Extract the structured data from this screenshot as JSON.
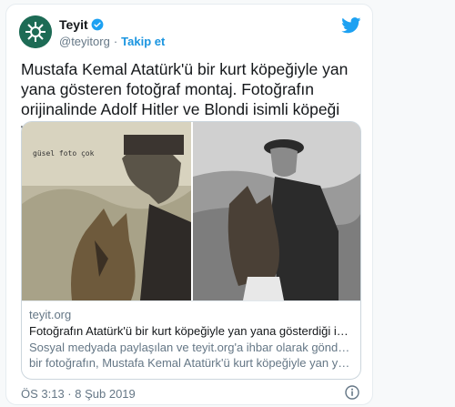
{
  "user": {
    "name": "Teyit",
    "handle": "@teyitorg",
    "separator": "·",
    "follow_label": "Takip et"
  },
  "tweet": {
    "text": "Mustafa Kemal Atatürk'ü bir kurt köpeğiyle yan yana gösteren fotoğraf montaj. Fotoğrafın orijinalinde Adolf Hitler ve Blondi isimli köpeği yer alıyor."
  },
  "card": {
    "photo_caption": "güsel foto çok",
    "domain": "teyit.org",
    "title": "Fotoğrafın Atatürk'ü bir kurt köpeğiyle yan yana gösterdiği iddia...",
    "desc_line1": "Sosyal medyada paylaşılan ve teyit.org'a ihbar olarak gönderilen",
    "desc_line2": "bir fotoğrafın, Mustafa Kemal Atatürk'ü kurt köpeğiyle yan yana ..."
  },
  "footer": {
    "timestamp": "ÖS 3:13 · 8 Şub 2019"
  },
  "colors": {
    "accent": "#1b95e0",
    "verified": "#1da1f2",
    "avatar": "#1d6b55"
  },
  "icons": [
    "verified-badge-icon",
    "twitter-bird-icon",
    "info-icon"
  ]
}
